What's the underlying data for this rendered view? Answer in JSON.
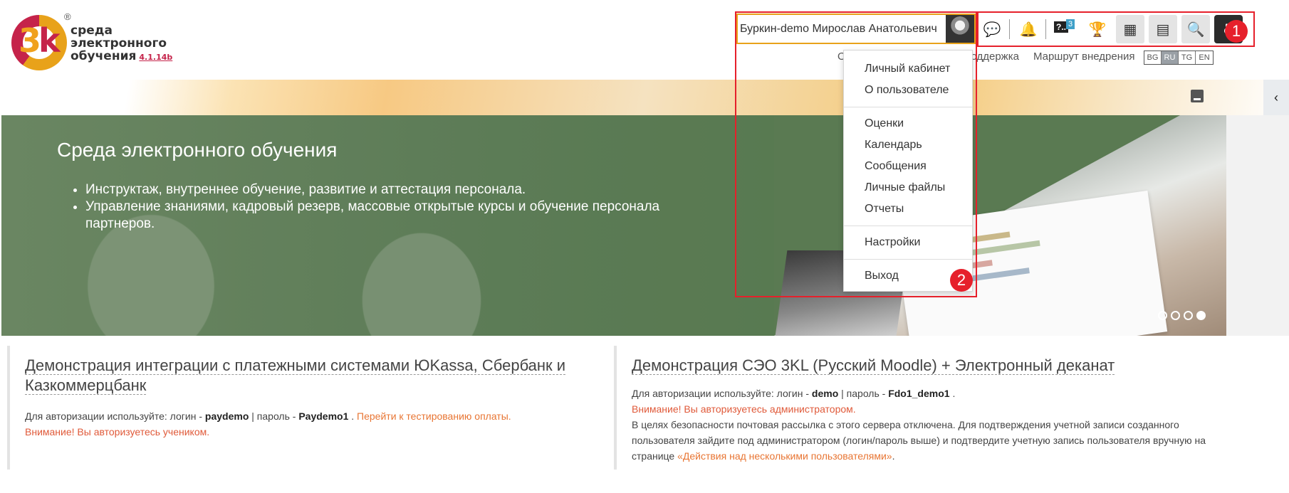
{
  "logo": {
    "glyph_main": "3",
    "glyph_accent": "k",
    "registered": "®",
    "line1": "среда",
    "line2": "электронного",
    "line3": "обучения",
    "version": "4.1.14b"
  },
  "user": {
    "name": "Буркин-demo Мирослав Анатольевич"
  },
  "toolbar": {
    "messages_icon": "💬",
    "notifications_icon": "🔔",
    "questions_badge": "?..",
    "questions_count": "3",
    "trophy_icon": "🏆",
    "dashboard_icon": "▦",
    "catalog_icon": "▤",
    "search_icon": "🔍",
    "accessibility_icon": "♿"
  },
  "markers": {
    "m1": "1",
    "m2": "2"
  },
  "topnav": {
    "item1": "О",
    "item2": "Поддержка",
    "item3": "Маршрут внедрения"
  },
  "languages": [
    "BG",
    "RU",
    "TG",
    "EN"
  ],
  "active_language": "RU",
  "dropdown": {
    "group1": [
      "Личный кабинет",
      "О пользователе"
    ],
    "group2": [
      "Оценки",
      "Календарь",
      "Сообщения",
      "Личные файлы",
      "Отчеты"
    ],
    "group3": [
      "Настройки"
    ],
    "group4": [
      "Выход"
    ]
  },
  "hero": {
    "title": "Среда электронного обучения",
    "bullets": [
      "Инструктаж, внутреннее обучение, развитие и аттестация персонала.",
      "Управление знаниями, кадровый резерв, массовые открытые курсы и обучение персонала партнеров."
    ],
    "slides": 4,
    "active_slide": 4
  },
  "cards": [
    {
      "title": "Демонстрация интеграции с платежными системами ЮKassa, Сбербанк и Казкоммерцбанк",
      "auth_prefix": "Для авторизации используйте: логин - ",
      "login": "paydemo",
      "sep": " | пароль - ",
      "password": "Paydemo1",
      "dot": " . ",
      "link": "Перейти к тестированию оплаты.",
      "warning": "Внимание! Вы авторизуетесь учеником."
    },
    {
      "title": "Демонстрация СЭО 3KL (Русский Moodle) + Электронный деканат",
      "auth_prefix": "Для авторизации используйте: логин - ",
      "login": "demo",
      "sep": " | пароль - ",
      "password": "Fdo1_demo1",
      "dot": " .",
      "warning": "Внимание! Вы авторизуетесь администратором.",
      "note": "В целях безопасности почтовая рассылка с этого сервера отключена. Для подтверждения учетной записи созданного пользователя зайдите под администратором (логин/пароль выше) и подтвердите учетную запись пользователя вручную на странице ",
      "note_link": "«Действия над несколькими пользователями»",
      "note_end": "."
    }
  ]
}
